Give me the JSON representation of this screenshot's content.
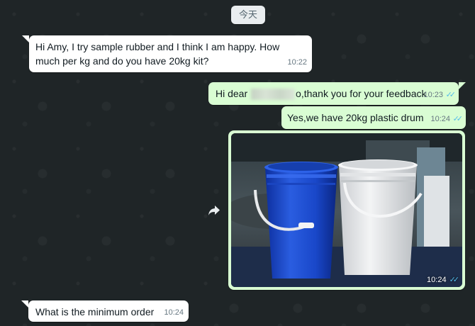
{
  "date_divider": "今天",
  "messages": [
    {
      "direction": "in",
      "text": "Hi Amy, I try sample rubber and I think I am happy. How much per kg and do you have 20kg kit?",
      "time": "10:22"
    },
    {
      "direction": "out",
      "text_before": "Hi dear ",
      "text_after": "o,thank you for your feedback",
      "time": "10:23",
      "status": "read"
    },
    {
      "direction": "out",
      "text": "Yes,we have 20kg plastic drum",
      "time": "10:24",
      "status": "read"
    },
    {
      "direction": "out",
      "type": "image",
      "image_alt": "blue-and-white-plastic-buckets",
      "time": "10:24",
      "status": "read"
    },
    {
      "direction": "in",
      "text": "What is the minimum order",
      "time": "10:24"
    }
  ],
  "ticks_symbol": "✓✓",
  "colors": {
    "incoming_bubble": "#ffffff",
    "outgoing_bubble": "#d9fdd3",
    "read_ticks": "#53bdeb",
    "wallpaper": "#1f2527"
  },
  "icons": {
    "forward": "forward-icon"
  }
}
